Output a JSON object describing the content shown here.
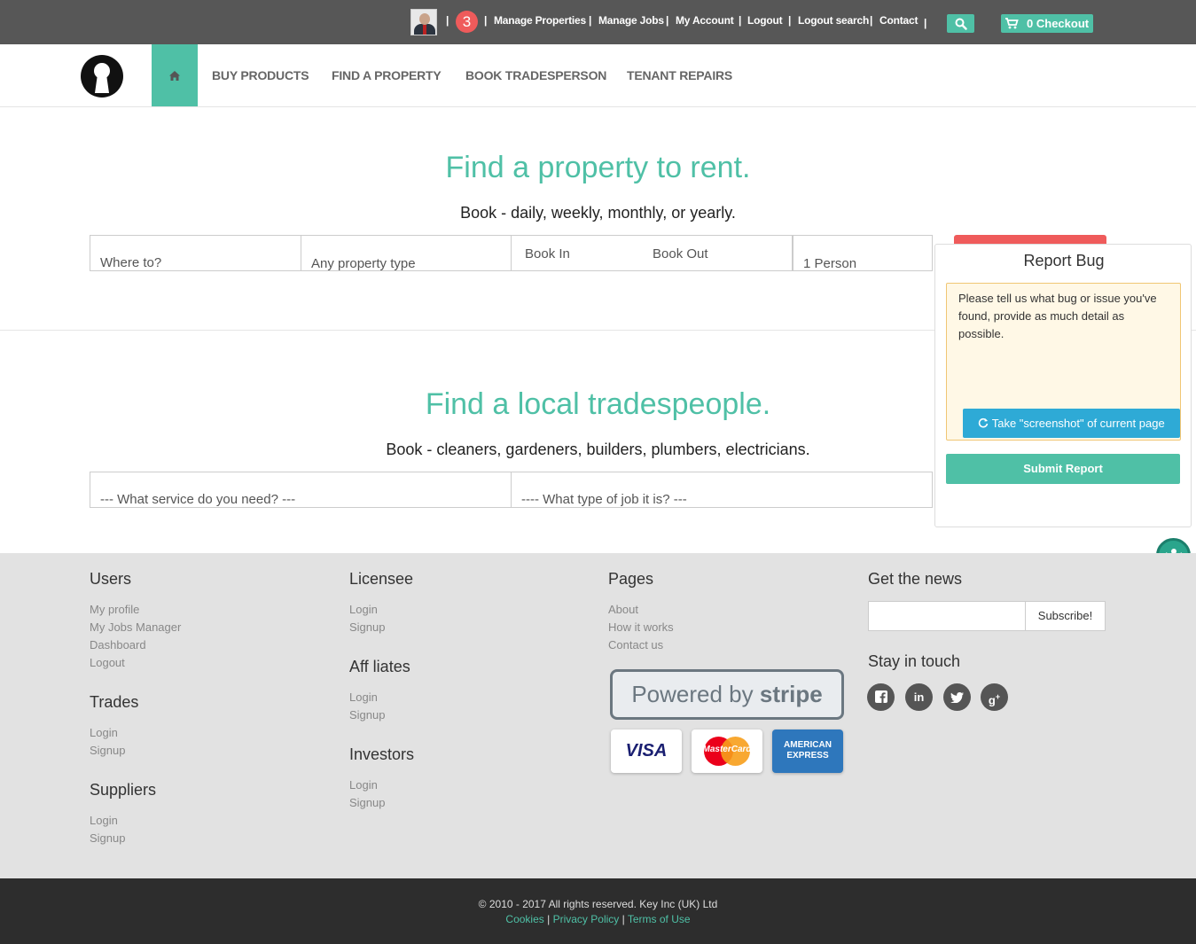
{
  "topbar": {
    "notification_count": "3",
    "links": [
      "Manage Properties",
      "Manage Jobs",
      "My Account",
      "Logout",
      "Logout search",
      "Contact"
    ],
    "separator": "|",
    "checkout_count": "0",
    "checkout_label": "Checkout"
  },
  "nav": {
    "items": [
      "BUY PRODUCTS",
      "FIND A PROPERTY",
      "BOOK TRADESPERSON",
      "TENANT REPAIRS"
    ]
  },
  "property": {
    "heading": "Find a property to rent.",
    "subheading": "Book - daily, weekly, monthly, or yearly.",
    "where_placeholder": "Where to?",
    "type_placeholder": "Any property type",
    "book_in": "Book In",
    "book_out": "Book Out",
    "persons": "1 Person"
  },
  "trades": {
    "heading": "Find a local tradespeople.",
    "subheading": "Book - cleaners, gardeners, builders, plumbers, electricians.",
    "service_placeholder": "--- What service do you need? ---",
    "job_placeholder": "---- What type of job it is? ---"
  },
  "report_bug": {
    "title": "Report Bug",
    "placeholder": "Please tell us what bug or issue you've found, provide as much detail as possible.",
    "screenshot_label": "Take \"screenshot\" of current page",
    "submit_label": "Submit Report"
  },
  "footer": {
    "users": {
      "title": "Users",
      "links": [
        "My profile",
        "My Jobs Manager",
        "Dashboard",
        "Logout"
      ]
    },
    "trades": {
      "title": "Trades",
      "links": [
        "Login",
        "Signup"
      ]
    },
    "suppliers": {
      "title": "Suppliers",
      "links": [
        "Login",
        "Signup"
      ]
    },
    "licensee": {
      "title": "Licensee",
      "links": [
        "Login",
        "Signup"
      ]
    },
    "affiliates": {
      "title": "Aff liates",
      "links": [
        "Login",
        "Signup"
      ]
    },
    "investors": {
      "title": "Investors",
      "links": [
        "Login",
        "Signup"
      ]
    },
    "pages": {
      "title": "Pages",
      "links": [
        "About",
        "How it works",
        "Contact us"
      ]
    },
    "news": {
      "title": "Get the news",
      "subscribe_label": "Subscribe!"
    },
    "touch": {
      "title": "Stay in touch",
      "icons": [
        "facebook-icon",
        "linkedin-icon",
        "twitter-icon",
        "google-plus-icon"
      ]
    },
    "stripe": {
      "prefix": "Powered by",
      "brand": "stripe"
    },
    "cards": [
      "VISA",
      "MasterCard",
      "AMERICAN EXPRESS"
    ]
  },
  "bottom": {
    "copyright": "© 2010 - 2017 All rights reserved. Key Inc (UK) Ltd",
    "cookies": "Cookies",
    "privacy": "Privacy Policy",
    "terms": "Terms of Use",
    "separator": "|"
  },
  "colors": {
    "accent": "#4fc0a6",
    "danger": "#ef5b5b",
    "topbar": "#575757",
    "footer": "#e2e2e2",
    "bottombar": "#2d2d2d"
  }
}
